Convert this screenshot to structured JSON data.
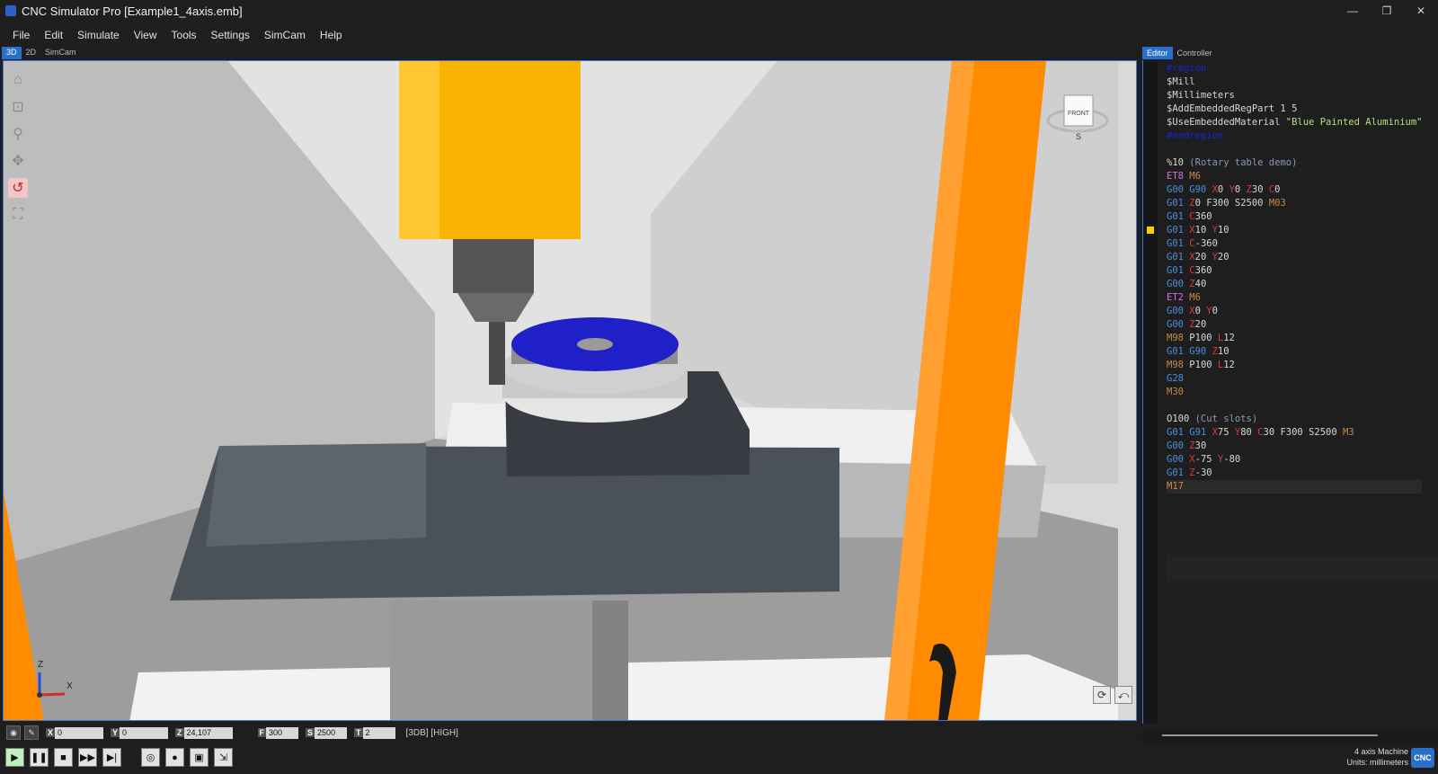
{
  "window": {
    "title": "CNC Simulator Pro [Example1_4axis.emb]",
    "minimize": "—",
    "restore": "❐",
    "close": "✕"
  },
  "menu": [
    "File",
    "Edit",
    "Simulate",
    "View",
    "Tools",
    "Settings",
    "SimCam",
    "Help"
  ],
  "view_tabs": [
    "3D",
    "2D",
    "SimCam"
  ],
  "viewport": {
    "viewcube_label": "FRONT",
    "compass_label": "S",
    "axis_z": "Z",
    "axis_x": "X"
  },
  "status": {
    "x_label": "X",
    "x_value": "0",
    "y_label": "Y",
    "y_value": "0",
    "z_label": "Z",
    "z_value": "24,107",
    "f_label": "F",
    "f_value": "300",
    "s_label": "S",
    "s_value": "2500",
    "t_label": "T",
    "t_value": "2",
    "resolution": "[3DB] [HIGH]"
  },
  "editor_tabs": [
    "Editor",
    "Controller"
  ],
  "machine": {
    "type": "4 axis Machine",
    "units": "Units: millimeters",
    "badge": "CNC"
  },
  "code_lines": [
    [
      [
        "#region",
        "#2222d6"
      ]
    ],
    [
      [
        "$Mill",
        "#d8d8d8"
      ]
    ],
    [
      [
        "$Millimeters",
        "#d8d8d8"
      ]
    ],
    [
      [
        "$AddEmbeddedRegPart 1 5",
        "#d8d8d8"
      ]
    ],
    [
      [
        "$UseEmbeddedMaterial ",
        "#d8d8d8"
      ],
      [
        "\"Blue Painted Aluminium\"",
        "#b5e07a"
      ]
    ],
    [
      [
        "#endregion",
        "#2222d6"
      ]
    ],
    [],
    [
      [
        "%10 ",
        "#d8d8d8"
      ],
      [
        "(Rotary table demo)",
        "#8a9ab5"
      ]
    ],
    [
      [
        "ET8 ",
        "#e06dd6"
      ],
      [
        "M6",
        "#c98a46"
      ]
    ],
    [
      [
        "G00 G90 ",
        "#4a8fe0"
      ],
      [
        "X",
        "#e03a3a"
      ],
      [
        "0 ",
        "#d8d8d8"
      ],
      [
        "Y",
        "#e03a3a"
      ],
      [
        "0 ",
        "#d8d8d8"
      ],
      [
        "Z",
        "#e03a3a"
      ],
      [
        "30 ",
        "#d8d8d8"
      ],
      [
        "C",
        "#e03a3a"
      ],
      [
        "0",
        "#d8d8d8"
      ]
    ],
    [
      [
        "G01 ",
        "#4a8fe0"
      ],
      [
        "Z",
        "#e03a3a"
      ],
      [
        "0 ",
        "#d8d8d8"
      ],
      [
        "F300 S2500 ",
        "#d8d8d8"
      ],
      [
        "M03",
        "#c98a46"
      ]
    ],
    [
      [
        "G01 ",
        "#4a8fe0"
      ],
      [
        "C",
        "#e03a3a"
      ],
      [
        "360",
        "#d8d8d8"
      ]
    ],
    [
      [
        "G01 ",
        "#4a8fe0"
      ],
      [
        "X",
        "#e03a3a"
      ],
      [
        "10 ",
        "#d8d8d8"
      ],
      [
        "Y",
        "#e03a3a"
      ],
      [
        "10",
        "#d8d8d8"
      ]
    ],
    [
      [
        "G01 ",
        "#4a8fe0"
      ],
      [
        "C",
        "#e03a3a"
      ],
      [
        "-360",
        "#d8d8d8"
      ]
    ],
    [
      [
        "G01 ",
        "#4a8fe0"
      ],
      [
        "X",
        "#e03a3a"
      ],
      [
        "20 ",
        "#d8d8d8"
      ],
      [
        "Y",
        "#e03a3a"
      ],
      [
        "20",
        "#d8d8d8"
      ]
    ],
    [
      [
        "G01 ",
        "#4a8fe0"
      ],
      [
        "C",
        "#e03a3a"
      ],
      [
        "360",
        "#d8d8d8"
      ]
    ],
    [
      [
        "G00 ",
        "#4a8fe0"
      ],
      [
        "Z",
        "#e03a3a"
      ],
      [
        "40",
        "#d8d8d8"
      ]
    ],
    [
      [
        "ET2 ",
        "#e06dd6"
      ],
      [
        "M6",
        "#c98a46"
      ]
    ],
    [
      [
        "G00 ",
        "#4a8fe0"
      ],
      [
        "X",
        "#e03a3a"
      ],
      [
        "0 ",
        "#d8d8d8"
      ],
      [
        "Y",
        "#e03a3a"
      ],
      [
        "0",
        "#d8d8d8"
      ]
    ],
    [
      [
        "G00 ",
        "#4a8fe0"
      ],
      [
        "Z",
        "#e03a3a"
      ],
      [
        "20",
        "#d8d8d8"
      ]
    ],
    [
      [
        "M98 ",
        "#c98a46"
      ],
      [
        "P100 ",
        "#d8d8d8"
      ],
      [
        "L",
        "#e03a3a"
      ],
      [
        "12",
        "#d8d8d8"
      ]
    ],
    [
      [
        "G01 G90 ",
        "#4a8fe0"
      ],
      [
        "Z",
        "#e03a3a"
      ],
      [
        "10",
        "#d8d8d8"
      ]
    ],
    [
      [
        "M98 ",
        "#c98a46"
      ],
      [
        "P100 ",
        "#d8d8d8"
      ],
      [
        "L",
        "#e03a3a"
      ],
      [
        "12",
        "#d8d8d8"
      ]
    ],
    [
      [
        "G28",
        "#4a8fe0"
      ]
    ],
    [
      [
        "M30",
        "#c98a46"
      ]
    ],
    [],
    [
      [
        "O100 ",
        "#d8d8d8"
      ],
      [
        "(Cut slots)",
        "#8a9ab5"
      ]
    ],
    [
      [
        "G01 G91 ",
        "#4a8fe0"
      ],
      [
        "X",
        "#e03a3a"
      ],
      [
        "75 ",
        "#d8d8d8"
      ],
      [
        "Y",
        "#e03a3a"
      ],
      [
        "80 ",
        "#d8d8d8"
      ],
      [
        "C",
        "#e03a3a"
      ],
      [
        "30 ",
        "#d8d8d8"
      ],
      [
        "F300 S2500 ",
        "#d8d8d8"
      ],
      [
        "M3",
        "#c98a46"
      ]
    ],
    [
      [
        "G00 ",
        "#4a8fe0"
      ],
      [
        "Z",
        "#e03a3a"
      ],
      [
        "30",
        "#d8d8d8"
      ]
    ],
    [
      [
        "G00 ",
        "#4a8fe0"
      ],
      [
        "X",
        "#e03a3a"
      ],
      [
        "-75 ",
        "#d8d8d8"
      ],
      [
        "Y",
        "#e03a3a"
      ],
      [
        "-80",
        "#d8d8d8"
      ]
    ],
    [
      [
        "G01 ",
        "#4a8fe0"
      ],
      [
        "Z",
        "#e03a3a"
      ],
      [
        "-30",
        "#d8d8d8"
      ]
    ],
    [
      [
        "M17",
        "#c98a46"
      ]
    ]
  ]
}
